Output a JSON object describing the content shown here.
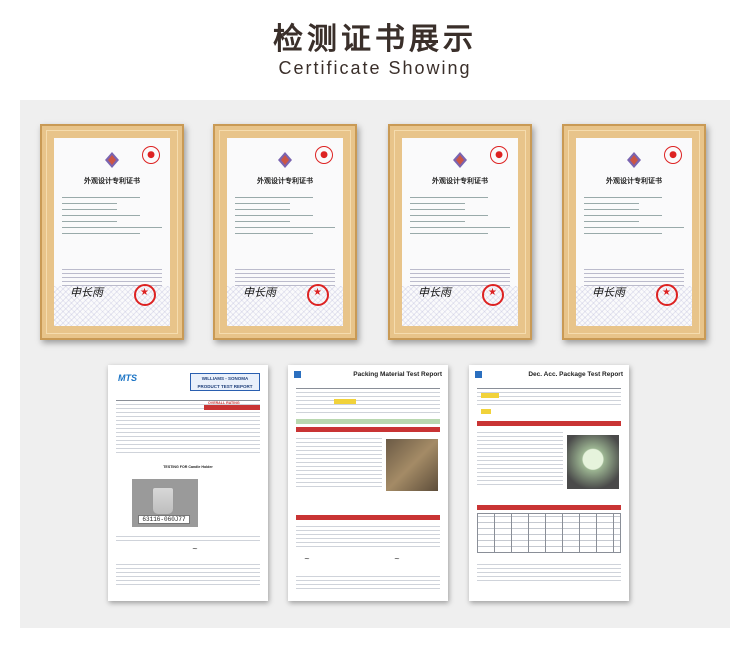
{
  "header": {
    "title_cn": "检测证书展示",
    "title_en": "Certificate Showing"
  },
  "certificates": [
    {
      "name": "外观设计专利证书",
      "signature": "申长雨"
    },
    {
      "name": "外观设计专利证书",
      "signature": "申长雨"
    },
    {
      "name": "外观设计专利证书",
      "signature": "申长雨"
    },
    {
      "name": "外观设计专利证书",
      "signature": "申长雨"
    }
  ],
  "reports": [
    {
      "brand": "MTS",
      "header": "WILLIAMS - SONOMA PRODUCT TEST REPORT",
      "rating": "OVERALL RATING",
      "testing_for": "TESTING FOR Candle Holder",
      "sample_code": "63116-060J77"
    },
    {
      "header": "Packing Material Test Report"
    },
    {
      "header": "Dec. Acc. Package Test Report"
    }
  ],
  "colors": {
    "title": "#3a2f2a",
    "frame": "#e8c48a",
    "panel": "#efefef",
    "report_red": "#c93434",
    "report_blue": "#1b74c5"
  }
}
